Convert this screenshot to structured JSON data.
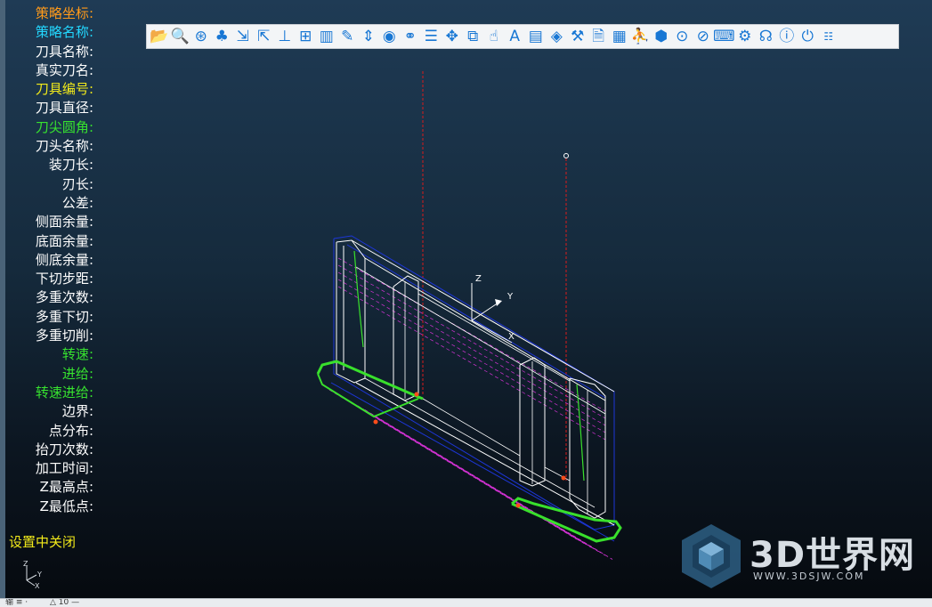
{
  "params": [
    {
      "label": "策略坐标",
      "value": "",
      "color": "orange"
    },
    {
      "label": "策略名称",
      "value": "",
      "color": "cyan"
    },
    {
      "label": "刀具名称",
      "value": "",
      "color": "white"
    },
    {
      "label": "真实刀名",
      "value": "",
      "color": "white"
    },
    {
      "label": "刀具编号",
      "value": "",
      "color": "yellow"
    },
    {
      "label": "刀具直径",
      "value": "",
      "color": "white"
    },
    {
      "label": "刀尖圆角",
      "value": "",
      "color": "green"
    },
    {
      "label": "刀头名称",
      "value": "",
      "color": "white"
    },
    {
      "label": "装刀长",
      "value": "",
      "color": "white"
    },
    {
      "label": "刃长",
      "value": "",
      "color": "white"
    },
    {
      "label": "公差",
      "value": "",
      "color": "white"
    },
    {
      "label": "侧面余量",
      "value": "",
      "color": "white"
    },
    {
      "label": "底面余量",
      "value": "",
      "color": "white"
    },
    {
      "label": "侧底余量",
      "value": "",
      "color": "white"
    },
    {
      "label": "下切步距",
      "value": "",
      "color": "white"
    },
    {
      "label": "多重次数",
      "value": "",
      "color": "white"
    },
    {
      "label": "多重下切",
      "value": "",
      "color": "white"
    },
    {
      "label": "多重切削",
      "value": "",
      "color": "white"
    },
    {
      "label": "转速",
      "value": "",
      "color": "green"
    },
    {
      "label": "进给",
      "value": "",
      "color": "green"
    },
    {
      "label": "转速进给",
      "value": "",
      "color": "green"
    },
    {
      "label": "边界",
      "value": "",
      "color": "white"
    },
    {
      "label": "点分布",
      "value": "",
      "color": "white"
    },
    {
      "label": "抬刀次数",
      "value": "",
      "color": "white"
    },
    {
      "label": "加工时间",
      "value": "",
      "color": "white"
    },
    {
      "label": "Z最高点",
      "value": "",
      "color": "white"
    },
    {
      "label": "Z最低点",
      "value": "",
      "color": "white"
    }
  ],
  "settings_toggle": "设置中关闭",
  "toolbar": {
    "buttons": [
      {
        "name": "open-folder",
        "glyph": "📂"
      },
      {
        "name": "zoom",
        "glyph": "🔍"
      },
      {
        "name": "toolpath-web",
        "glyph": "⊛"
      },
      {
        "name": "cluster",
        "glyph": "♣"
      },
      {
        "name": "export",
        "glyph": "⇲"
      },
      {
        "name": "import",
        "glyph": "⇱"
      },
      {
        "name": "z-axis-plot",
        "glyph": "⊥"
      },
      {
        "name": "grid",
        "glyph": "⊞"
      },
      {
        "name": "book",
        "glyph": "▥"
      },
      {
        "name": "edit",
        "glyph": "✎"
      },
      {
        "name": "reorder",
        "glyph": "⇕"
      },
      {
        "name": "view",
        "glyph": "◉"
      },
      {
        "name": "link",
        "glyph": "⚭"
      },
      {
        "name": "list",
        "glyph": "☰"
      },
      {
        "name": "move",
        "glyph": "✥"
      },
      {
        "name": "copy",
        "glyph": "⧉"
      },
      {
        "name": "hand",
        "glyph": "☝"
      },
      {
        "name": "text",
        "glyph": "A"
      },
      {
        "name": "document",
        "glyph": "▤"
      },
      {
        "name": "layers",
        "glyph": "◈"
      },
      {
        "name": "tools",
        "glyph": "⚒"
      },
      {
        "name": "report",
        "glyph": "🗎"
      },
      {
        "name": "excel",
        "glyph": "▦"
      },
      {
        "name": "run",
        "glyph": "⛹"
      },
      {
        "name": "box",
        "glyph": "⬢"
      },
      {
        "name": "target",
        "glyph": "⊙"
      },
      {
        "name": "no",
        "glyph": "⊘"
      },
      {
        "name": "keyboard",
        "glyph": "⌨"
      },
      {
        "name": "gear",
        "glyph": "⚙"
      },
      {
        "name": "headset",
        "glyph": "☊"
      },
      {
        "name": "info",
        "glyph": "ⓘ"
      },
      {
        "name": "power",
        "glyph": "⏻"
      },
      {
        "name": "settings-cn",
        "glyph": "☷"
      }
    ]
  },
  "axis_labels": {
    "z": "Z",
    "y": "Y",
    "x": "X"
  },
  "watermark": {
    "title": "3D世界网",
    "url": "WWW.3DSJW.COM"
  },
  "status": {
    "left": "输 ≡ ·",
    "right": "△ 10 —"
  },
  "colors": {
    "frame": "#ffffff",
    "outline": "#1d36d8",
    "toolpath": "#39e02c",
    "hatch": "#d833d8",
    "marker": "#ff4d1a",
    "axis_line": "#d81b1b"
  }
}
